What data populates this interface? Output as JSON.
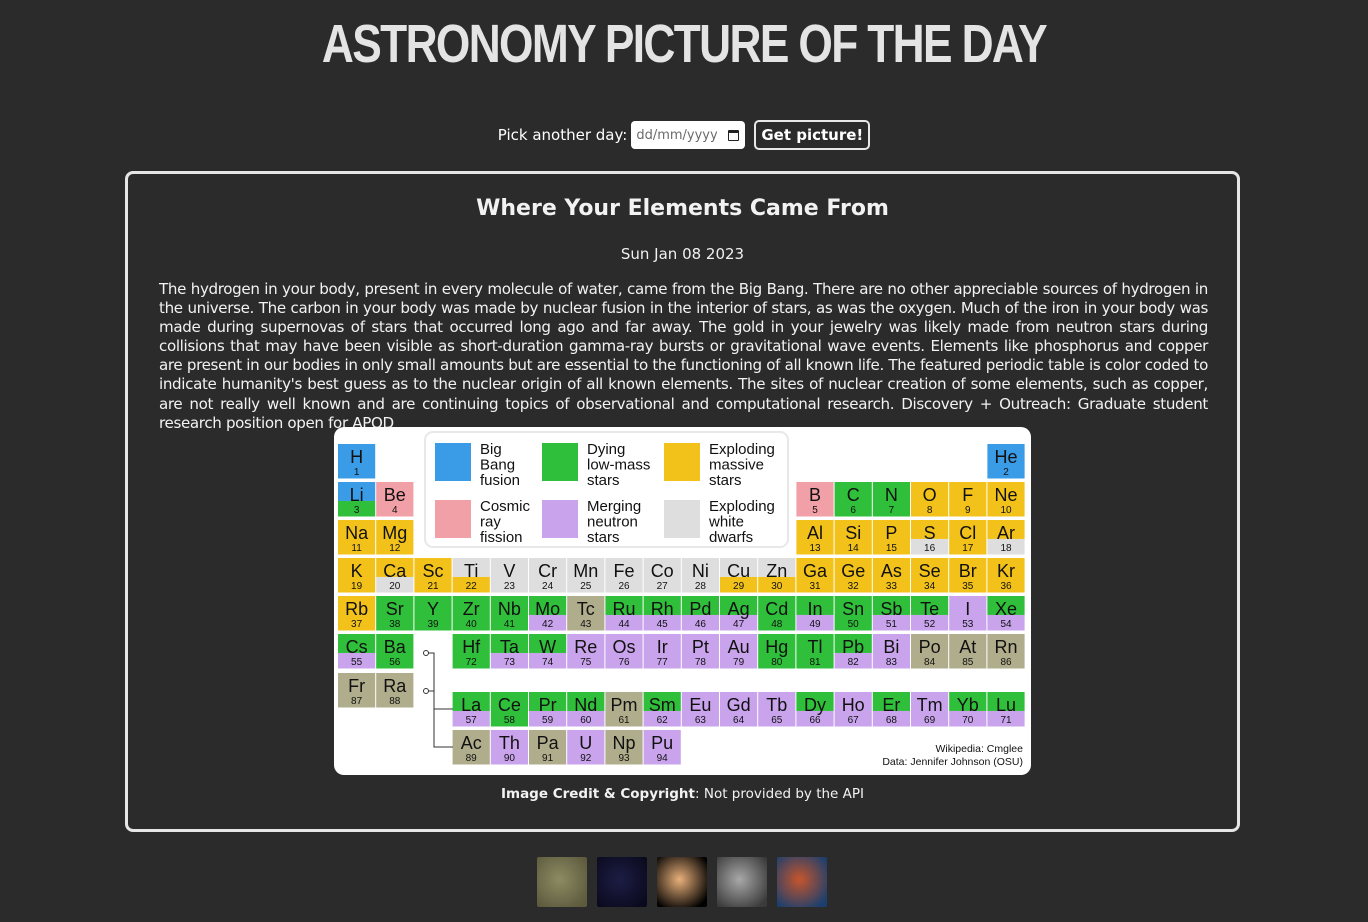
{
  "header": {
    "title": "ASTRONOMY PICTURE OF THE DAY"
  },
  "picker": {
    "label": "Pick another day:",
    "date_placeholder": "dd/mm/yyyy",
    "button_label": "Get picture!",
    "calendar_icon": "calendar-icon"
  },
  "apod": {
    "title": "Where Your Elements Came From",
    "date": "Sun Jan 08 2023",
    "explanation": "The hydrogen in your body, present in every molecule of water, came from the Big Bang. There are no other appreciable sources of hydrogen in the universe. The carbon in your body was made by nuclear fusion in the interior of stars, as was the oxygen. Much of the iron in your body was made during supernovas of stars that occurred long ago and far away. The gold in your jewelry was likely made from neutron stars during collisions that may have been visible as short-duration gamma-ray bursts or gravitational wave events. Elements like phosphorus and copper are present in our bodies in only small amounts but are essential to the functioning of all known life. The featured periodic table is color coded to indicate humanity's best guess as to the nuclear origin of all known elements. The sites of nuclear creation of some elements, such as copper, are not really well known and are continuing topics of observational and computational research. Discovery + Outreach: Graduate student research position open for APOD",
    "credit_label": "Image Credit & Copyright",
    "credit_value": ": Not provided by the API"
  },
  "periodic_table": {
    "legend": [
      {
        "label": [
          "Big",
          "Bang",
          "fusion"
        ],
        "color": "#3a9be6"
      },
      {
        "label": [
          "Dying",
          "low-mass",
          "stars"
        ],
        "color": "#2fbf3a"
      },
      {
        "label": [
          "Exploding",
          "massive",
          "stars"
        ],
        "color": "#f2c21a"
      },
      {
        "label": [
          "Cosmic",
          "ray",
          "fission"
        ],
        "color": "#f0a0a6"
      },
      {
        "label": [
          "Merging",
          "neutron",
          "stars"
        ],
        "color": "#c9a4ec"
      },
      {
        "label": [
          "Exploding",
          "white",
          "dwarfs"
        ],
        "color": "#dedede"
      }
    ],
    "source_lines": [
      "Wikipedia: Cmglee",
      "Data: Jennifer Johnson (OSU)"
    ],
    "elements": [
      [
        "H",
        1,
        1,
        1,
        "b"
      ],
      [
        "He",
        2,
        1,
        18,
        "b"
      ],
      [
        "Li",
        3,
        2,
        1,
        "bg"
      ],
      [
        "Be",
        4,
        2,
        2,
        "p"
      ],
      [
        "B",
        5,
        2,
        13,
        "p"
      ],
      [
        "C",
        6,
        2,
        14,
        "g"
      ],
      [
        "N",
        7,
        2,
        15,
        "g"
      ],
      [
        "O",
        8,
        2,
        16,
        "y"
      ],
      [
        "F",
        9,
        2,
        17,
        "y"
      ],
      [
        "Ne",
        10,
        2,
        18,
        "y"
      ],
      [
        "Na",
        11,
        3,
        1,
        "y"
      ],
      [
        "Mg",
        12,
        3,
        2,
        "y"
      ],
      [
        "Al",
        13,
        3,
        13,
        "y"
      ],
      [
        "Si",
        14,
        3,
        14,
        "y"
      ],
      [
        "P",
        15,
        3,
        15,
        "y"
      ],
      [
        "S",
        16,
        3,
        16,
        "yw"
      ],
      [
        "Cl",
        17,
        3,
        17,
        "y"
      ],
      [
        "Ar",
        18,
        3,
        18,
        "yw"
      ],
      [
        "K",
        19,
        4,
        1,
        "y"
      ],
      [
        "Ca",
        20,
        4,
        2,
        "yw"
      ],
      [
        "Sc",
        21,
        4,
        3,
        "y"
      ],
      [
        "Ti",
        22,
        4,
        4,
        "wy"
      ],
      [
        "V",
        23,
        4,
        5,
        "w"
      ],
      [
        "Cr",
        24,
        4,
        6,
        "w"
      ],
      [
        "Mn",
        25,
        4,
        7,
        "w"
      ],
      [
        "Fe",
        26,
        4,
        8,
        "w"
      ],
      [
        "Co",
        27,
        4,
        9,
        "w"
      ],
      [
        "Ni",
        28,
        4,
        10,
        "w"
      ],
      [
        "Cu",
        29,
        4,
        11,
        "wy"
      ],
      [
        "Zn",
        30,
        4,
        12,
        "wy"
      ],
      [
        "Ga",
        31,
        4,
        13,
        "y"
      ],
      [
        "Ge",
        32,
        4,
        14,
        "y"
      ],
      [
        "As",
        33,
        4,
        15,
        "y"
      ],
      [
        "Se",
        34,
        4,
        16,
        "y"
      ],
      [
        "Br",
        35,
        4,
        17,
        "y"
      ],
      [
        "Kr",
        36,
        4,
        18,
        "y"
      ],
      [
        "Rb",
        37,
        5,
        1,
        "y"
      ],
      [
        "Sr",
        38,
        5,
        2,
        "g"
      ],
      [
        "Y",
        39,
        5,
        3,
        "g"
      ],
      [
        "Zr",
        40,
        5,
        4,
        "g"
      ],
      [
        "Nb",
        41,
        5,
        5,
        "g"
      ],
      [
        "Mo",
        42,
        5,
        6,
        "gm"
      ],
      [
        "Tc",
        43,
        5,
        7,
        "o"
      ],
      [
        "Ru",
        44,
        5,
        8,
        "gm"
      ],
      [
        "Rh",
        45,
        5,
        9,
        "gm"
      ],
      [
        "Pd",
        46,
        5,
        10,
        "gm"
      ],
      [
        "Ag",
        47,
        5,
        11,
        "gm"
      ],
      [
        "Cd",
        48,
        5,
        12,
        "g"
      ],
      [
        "In",
        49,
        5,
        13,
        "gm"
      ],
      [
        "Sn",
        50,
        5,
        14,
        "g"
      ],
      [
        "Sb",
        51,
        5,
        15,
        "gm"
      ],
      [
        "Te",
        52,
        5,
        16,
        "gm"
      ],
      [
        "I",
        53,
        5,
        17,
        "m"
      ],
      [
        "Xe",
        54,
        5,
        18,
        "gm"
      ],
      [
        "Cs",
        55,
        6,
        1,
        "gm"
      ],
      [
        "Ba",
        56,
        6,
        2,
        "g"
      ],
      [
        "Hf",
        72,
        6,
        4,
        "g"
      ],
      [
        "Ta",
        73,
        6,
        5,
        "gm"
      ],
      [
        "W",
        74,
        6,
        6,
        "gm"
      ],
      [
        "Re",
        75,
        6,
        7,
        "m"
      ],
      [
        "Os",
        76,
        6,
        8,
        "m"
      ],
      [
        "Ir",
        77,
        6,
        9,
        "m"
      ],
      [
        "Pt",
        78,
        6,
        10,
        "m"
      ],
      [
        "Au",
        79,
        6,
        11,
        "m"
      ],
      [
        "Hg",
        80,
        6,
        12,
        "g"
      ],
      [
        "Tl",
        81,
        6,
        13,
        "g"
      ],
      [
        "Pb",
        82,
        6,
        14,
        "gm"
      ],
      [
        "Bi",
        83,
        6,
        15,
        "m"
      ],
      [
        "Po",
        84,
        6,
        16,
        "o"
      ],
      [
        "At",
        85,
        6,
        17,
        "o"
      ],
      [
        "Rn",
        86,
        6,
        18,
        "o"
      ],
      [
        "Fr",
        87,
        7,
        1,
        "o"
      ],
      [
        "Ra",
        88,
        7,
        2,
        "o"
      ],
      [
        "La",
        57,
        8,
        4,
        "gm"
      ],
      [
        "Ce",
        58,
        8,
        5,
        "g"
      ],
      [
        "Pr",
        59,
        8,
        6,
        "gm"
      ],
      [
        "Nd",
        60,
        8,
        7,
        "gm"
      ],
      [
        "Pm",
        61,
        8,
        8,
        "o"
      ],
      [
        "Sm",
        62,
        8,
        9,
        "gm"
      ],
      [
        "Eu",
        63,
        8,
        10,
        "m"
      ],
      [
        "Gd",
        64,
        8,
        11,
        "m"
      ],
      [
        "Tb",
        65,
        8,
        12,
        "m"
      ],
      [
        "Dy",
        66,
        8,
        13,
        "gm"
      ],
      [
        "Ho",
        67,
        8,
        14,
        "m"
      ],
      [
        "Er",
        68,
        8,
        15,
        "gm"
      ],
      [
        "Tm",
        69,
        8,
        16,
        "m"
      ],
      [
        "Yb",
        70,
        8,
        17,
        "gm"
      ],
      [
        "Lu",
        71,
        8,
        18,
        "gm"
      ],
      [
        "Ac",
        89,
        9,
        4,
        "o"
      ],
      [
        "Th",
        90,
        9,
        5,
        "m"
      ],
      [
        "Pa",
        91,
        9,
        6,
        "o"
      ],
      [
        "U",
        92,
        9,
        7,
        "m"
      ],
      [
        "Np",
        93,
        9,
        8,
        "o"
      ],
      [
        "Pu",
        94,
        9,
        9,
        "m"
      ]
    ],
    "origin_colors": {
      "b": "#3a9be6",
      "g": "#2fbf3a",
      "y": "#f2c21a",
      "p": "#f0a0a6",
      "m": "#c9a4ec",
      "w": "#dedede",
      "o": "#b0ad8c"
    }
  },
  "thumbnails": [
    {
      "name": "thumbnail-moon-surface",
      "colors": [
        "#8c8c62",
        "#5d5a3e"
      ]
    },
    {
      "name": "thumbnail-star-field",
      "colors": [
        "#1d1d45",
        "#0a0a1e"
      ]
    },
    {
      "name": "thumbnail-planet",
      "colors": [
        "#e9b07a",
        "#000000"
      ]
    },
    {
      "name": "thumbnail-grey-moon",
      "colors": [
        "#a8a8a8",
        "#3b3b3b"
      ]
    },
    {
      "name": "thumbnail-nebula",
      "colors": [
        "#c6552c",
        "#1b3f6e"
      ]
    }
  ]
}
